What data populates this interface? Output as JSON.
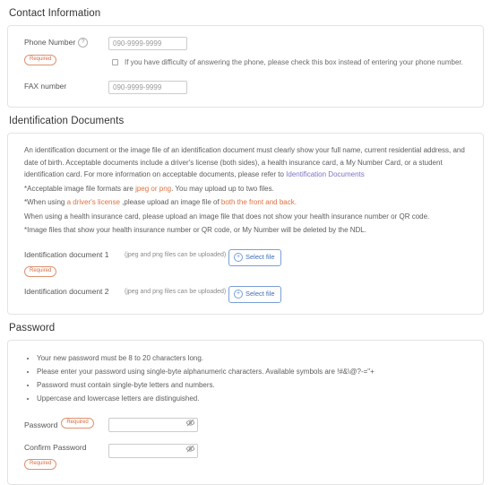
{
  "colors": {
    "required_text": "#d9693f",
    "required_border": "#e09272",
    "link": "#7b74c6",
    "highlight": "#e0713f",
    "button_blue": "#3f6fb8"
  },
  "contact": {
    "title": "Contact Information",
    "phone": {
      "label": "Phone Number",
      "help_icon": "question-circle-icon",
      "required_badge": "Required",
      "value": "",
      "placeholder": "090-9999-9999",
      "checkbox_label": "If you have difficulty of answering the phone, please check this box instead of entering your phone number."
    },
    "fax": {
      "label": "FAX number",
      "value": "",
      "placeholder": "090-9999-9999"
    }
  },
  "identification": {
    "title": "Identification Documents",
    "paragraph": {
      "part1": "An identification document or the image file of an identification document must clearly show your full name, current residential address, and date of birth. Acceptable documents include a driver's license (both sides), a health insurance card, a My Number Card, or a student identification card. For more information on acceptable documents, please refer to ",
      "link": "Identification Documents"
    },
    "note1": {
      "pre": "*Acceptable image file formats are ",
      "hl": "jpeg or png",
      "post": ". You may upload up to two files."
    },
    "note2": {
      "pre": "*When using ",
      "hl1": "a driver's license",
      "mid": " ,please upload an image file of ",
      "hl2": "both the front and back."
    },
    "note3": "When using a health insurance card, please upload an image file that does not show your health insurance number or QR code.",
    "note4": "*Image files that show your health insurance number or QR code, or My Number will be deleted by the NDL.",
    "documents": [
      {
        "label": "Identification document 1",
        "required_badge": "Required",
        "hint": "(jpeg and png files can be uploaded)",
        "button": "Select file",
        "button_icon": "plus-circle-icon"
      },
      {
        "label": "Identification document 2",
        "required_badge": "",
        "hint": "(jpeg and png files can be uploaded)",
        "button": "Select file",
        "button_icon": "plus-circle-icon"
      }
    ]
  },
  "password": {
    "title": "Password",
    "rules": [
      "Your new password must be 8 to 20 characters long.",
      "Please enter your password using single-byte alphanumeric characters. Available symbols are !#&\\@?-=\"+",
      "Password must contain single-byte letters and numbers.",
      "Uppercase and lowercase letters are distinguished."
    ],
    "fields": [
      {
        "label": "Password",
        "required_badge": "Required",
        "badge_inline": true,
        "value": "",
        "placeholder": "",
        "toggle_icon": "eye-slash-icon"
      },
      {
        "label": "Confirm Password",
        "required_badge": "Required",
        "badge_inline": false,
        "value": "",
        "placeholder": "",
        "toggle_icon": "eye-slash-icon"
      }
    ]
  }
}
